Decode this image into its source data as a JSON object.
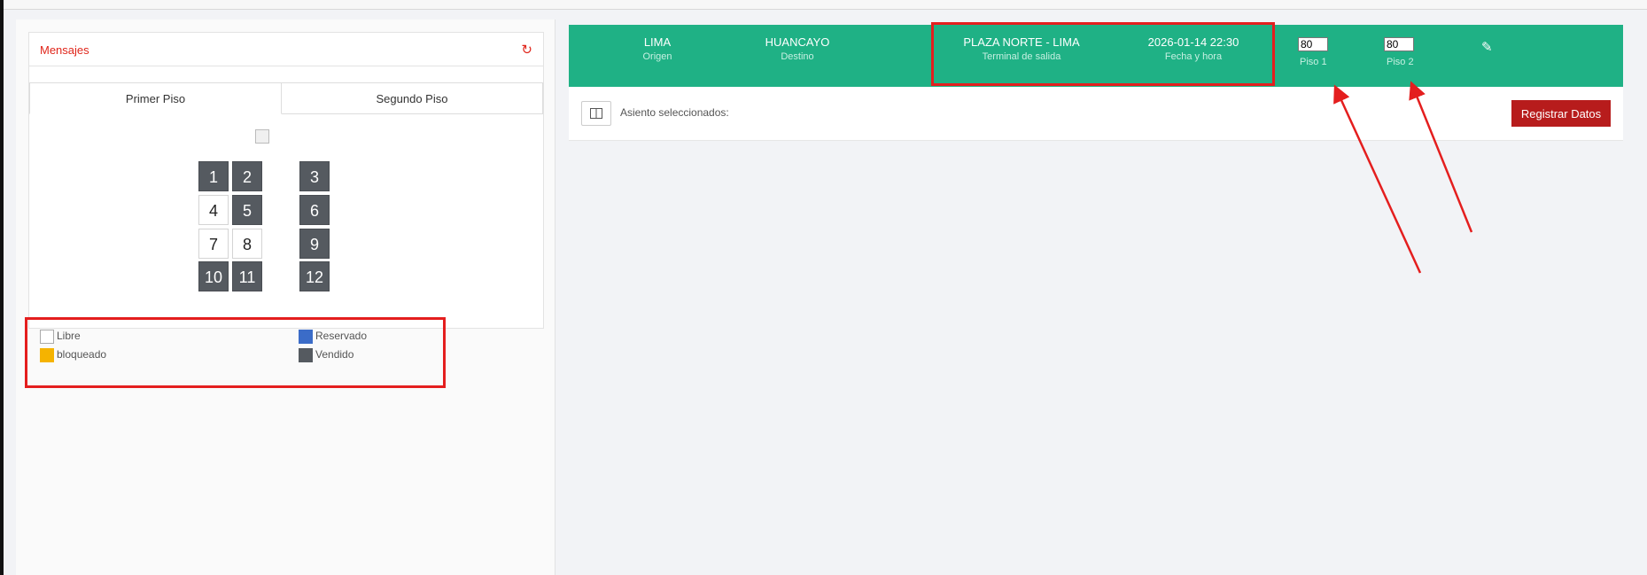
{
  "messages": {
    "title": "Mensajes"
  },
  "tabs": [
    {
      "label": "Primer Piso"
    },
    {
      "label": "Segundo Piso"
    }
  ],
  "seats": [
    {
      "number": "1",
      "status": "vendido"
    },
    {
      "number": "2",
      "status": "vendido"
    },
    {
      "number": "3",
      "status": "vendido"
    },
    {
      "number": "4",
      "status": "libre"
    },
    {
      "number": "5",
      "status": "vendido"
    },
    {
      "number": "6",
      "status": "vendido"
    },
    {
      "number": "7",
      "status": "libre"
    },
    {
      "number": "8",
      "status": "libre"
    },
    {
      "number": "9",
      "status": "vendido"
    },
    {
      "number": "10",
      "status": "vendido"
    },
    {
      "number": "11",
      "status": "vendido"
    },
    {
      "number": "12",
      "status": "vendido"
    }
  ],
  "legend": {
    "libre": {
      "label": "Libre",
      "color": "#ffffff"
    },
    "reservado": {
      "label": "Reservado",
      "color": "#3b6cc8"
    },
    "bloqueado": {
      "label": "bloqueado",
      "color": "#f5b300"
    },
    "vendido": {
      "label": "Vendido",
      "color": "#555a60"
    }
  },
  "trip": {
    "origin": {
      "value": "LIMA",
      "label": "Origen"
    },
    "destination": {
      "value": "HUANCAYO",
      "label": "Destino"
    },
    "terminal": {
      "value": "PLAZA NORTE - LIMA",
      "label": "Terminal de salida"
    },
    "datetime": {
      "value": "2026-01-14 22:30",
      "label": "Fecha y hora"
    },
    "piso1": {
      "value": "80",
      "label": "Piso 1"
    },
    "piso2": {
      "value": "80",
      "label": "Piso 2"
    }
  },
  "selection": {
    "text": "Asiento seleccionados:"
  },
  "actions": {
    "register_label": "Registrar Datos"
  },
  "colors": {
    "header": "#1fb185",
    "accent": "#e41e1e",
    "register": "#b71c1c"
  }
}
